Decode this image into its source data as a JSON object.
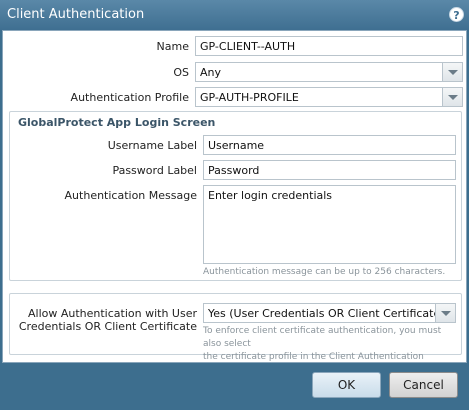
{
  "dialog": {
    "title": "Client Authentication",
    "help_icon": "question-circle-icon"
  },
  "form": {
    "name": {
      "label": "Name",
      "value": "GP-CLIENT--AUTH"
    },
    "os": {
      "label": "OS",
      "value": "Any"
    },
    "auth_profile": {
      "label": "Authentication Profile",
      "value": "GP-AUTH-PROFILE"
    }
  },
  "login_screen": {
    "title": "GlobalProtect App Login Screen",
    "username_label": {
      "label": "Username Label",
      "value": "Username"
    },
    "password_label": {
      "label": "Password Label",
      "value": "Password"
    },
    "auth_message": {
      "label": "Authentication Message",
      "value": "Enter login credentials",
      "hint": "Authentication message can be up to 256 characters."
    }
  },
  "allow_auth": {
    "label_line1": "Allow Authentication with User",
    "label_line2": "Credentials OR Client Certificate",
    "value": "Yes (User Credentials OR Client Certificate Req",
    "hint_line1": "To enforce client certificate authentication, you must also select",
    "hint_line2": "the certificate profile in the Client Authentication configuration."
  },
  "buttons": {
    "ok": "OK",
    "cancel": "Cancel"
  },
  "colors": {
    "accent": "#3d6e8e",
    "title_bar": "#4f7fa0"
  }
}
